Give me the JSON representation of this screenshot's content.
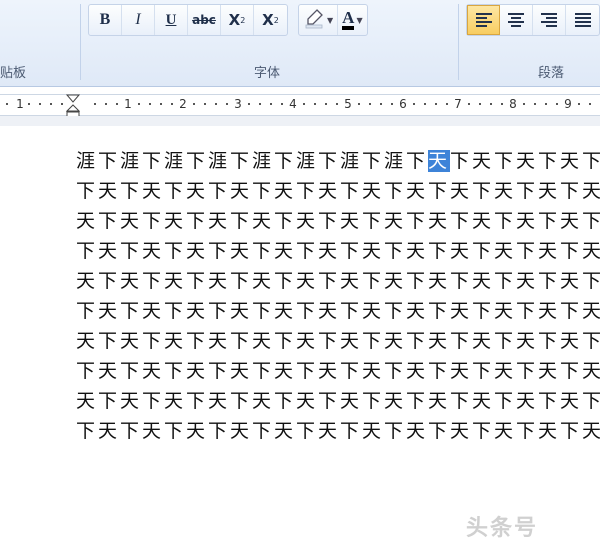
{
  "ribbon": {
    "clipboard_label": "贴板",
    "font_label": "字体",
    "paragraph_label": "段落",
    "bold_label": "B",
    "italic_label": "I",
    "underline_label": "U",
    "strike_label": "abc",
    "subscript_label": "X",
    "subscript_mark": "2",
    "superscript_label": "X",
    "superscript_mark": "2",
    "font_color_label": "A",
    "alignment_active": "left"
  },
  "ruler": {
    "numbers": [
      "1",
      "1",
      "2",
      "3",
      "4",
      "5",
      "6",
      "7",
      "8",
      "9"
    ]
  },
  "document": {
    "lines": [
      {
        "before": "涯下涯下涯下涯下涯下涯下涯下涯下",
        "selected": "天",
        "after": "下天下天下天下天"
      },
      {
        "before": "下天下天下天下天下天下天下天下天下天下天下天下天下",
        "selected": "",
        "after": ""
      },
      {
        "before": "天下天下天下天下天下天下天下天下天下天下天下天下天",
        "selected": "",
        "after": ""
      },
      {
        "before": "下天下天下天下天下天下天下天下天下天下天下天下天下",
        "selected": "",
        "after": ""
      },
      {
        "before": "天下天下天下天下天下天下天下天下天下天下天下天下天",
        "selected": "",
        "after": ""
      },
      {
        "before": "下天下天下天下天下天下天下天下天下天下天下天下天下",
        "selected": "",
        "after": ""
      },
      {
        "before": "天下天下天下天下天下天下天下天下天下天下天下天下天",
        "selected": "",
        "after": ""
      },
      {
        "before": "下天下天下天下天下天下天下天下天下天下天下天下天下",
        "selected": "",
        "after": ""
      },
      {
        "before": "天下天下天下天下天下天下天下天下天下天下天下天下天",
        "selected": "",
        "after": ""
      },
      {
        "before": "下天下天下天下天下天下天下天下天下天下天下天下天下",
        "selected": "",
        "after": ""
      }
    ]
  },
  "watermark": "头条号"
}
